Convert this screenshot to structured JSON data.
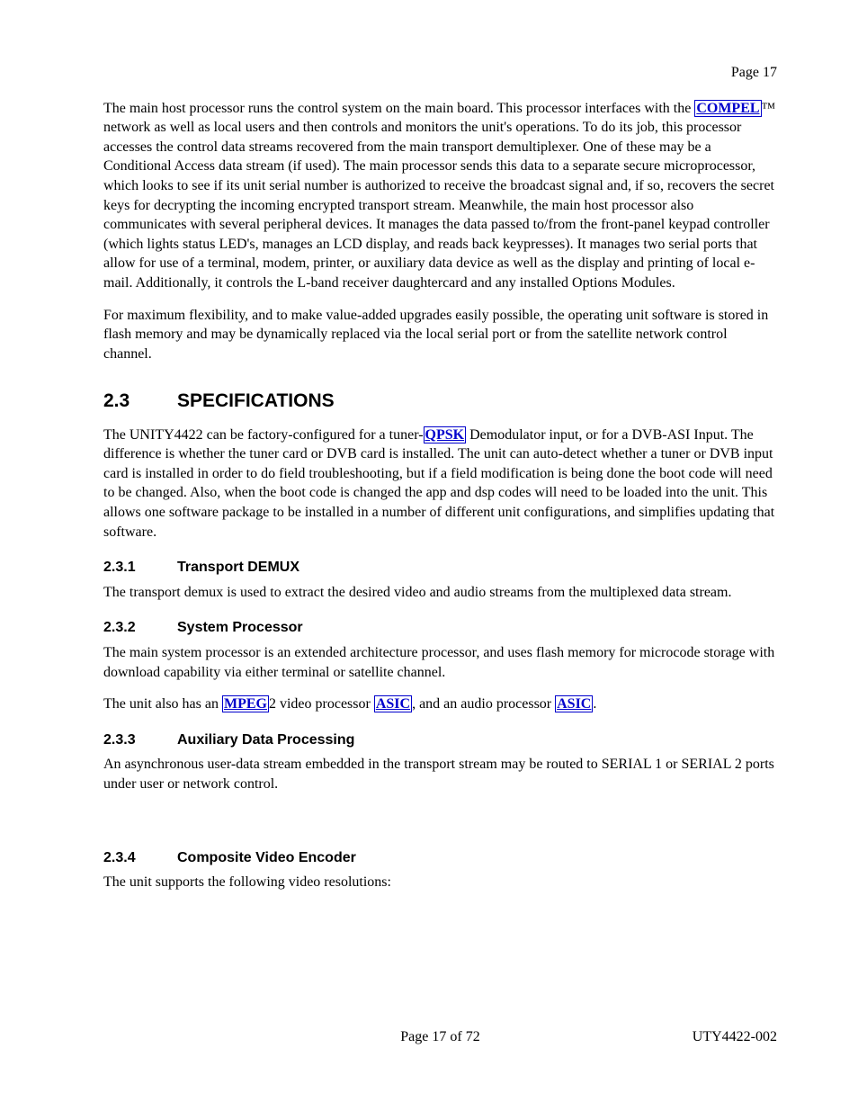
{
  "header": {
    "page_label": "Page 17"
  },
  "para1": {
    "t0": "The main host processor runs the control system on the main board.  This processor interfaces with the ",
    "link1": "COMPEL",
    "t1": "™ network as well as local users and then controls and monitors the unit's operations.  To do its job, this processor accesses the control data streams recovered from the main transport demultiplexer.  One of these may be a Conditional Access data stream (if used). The main processor sends this data to a separate secure microprocessor, which looks to see if its unit serial number is authorized to receive the broadcast signal and, if so, recovers the secret keys for decrypting the incoming encrypted transport stream.  Meanwhile, the main host processor also communicates with several peripheral devices.  It manages the data passed to/from the front-panel keypad controller (which lights status LED's, manages an LCD display, and reads back keypresses).  It manages two serial ports that allow for use of a terminal, modem, printer, or auxiliary data device as well as the display and printing of local e-mail.  Additionally, it controls the L-band receiver daughtercard and any installed Options Modules."
  },
  "para2": "For maximum flexibility, and to make value-added upgrades easily possible, the operating unit software is stored in flash memory and may be dynamically replaced via the local serial port or from the satellite network control channel.",
  "sec23": {
    "num": "2.3",
    "title": "SPECIFICATIONS"
  },
  "para23": {
    "t0": "The UNITY4422 can be factory-configured for a tuner-",
    "link1": "QPSK",
    "t1": " Demodulator input, or for a DVB-ASI Input.  The difference is whether the tuner card or DVB card is installed.  The unit can auto-detect whether a tuner or DVB input card is installed in order to do field troubleshooting, but if a field modification is being done the boot code will need to be changed.  Also, when the boot code is changed the app and dsp codes will need to be loaded into the unit.  This allows one software package to be installed in a number of different unit configurations, and simplifies updating that software."
  },
  "sec231": {
    "num": "2.3.1",
    "title": "Transport DEMUX"
  },
  "para231": "The transport demux is used to extract the desired video and audio streams from the multiplexed data stream.",
  "sec232": {
    "num": "2.3.2",
    "title": "System Processor"
  },
  "para232a": "The main system processor is an extended architecture processor, and uses flash memory for microcode storage with download capability via either terminal or satellite channel.",
  "para232b": {
    "t0": "The unit also has an ",
    "link1": "MPEG",
    "t1": "2 video processor ",
    "link2": "ASIC",
    "t2": ", and an audio processor ",
    "link3": "ASIC",
    "t3": "."
  },
  "sec233": {
    "num": "2.3.3",
    "title": "Auxiliary Data Processing"
  },
  "para233": "An asynchronous user-data stream embedded in the transport stream may be routed to SERIAL 1 or SERIAL 2 ports under user or network control.",
  "sec234": {
    "num": "2.3.4",
    "title": "Composite Video Encoder"
  },
  "para234": "The unit supports the following video resolutions:",
  "footer": {
    "center": "Page 17 of 72",
    "right": "UTY4422-002"
  }
}
